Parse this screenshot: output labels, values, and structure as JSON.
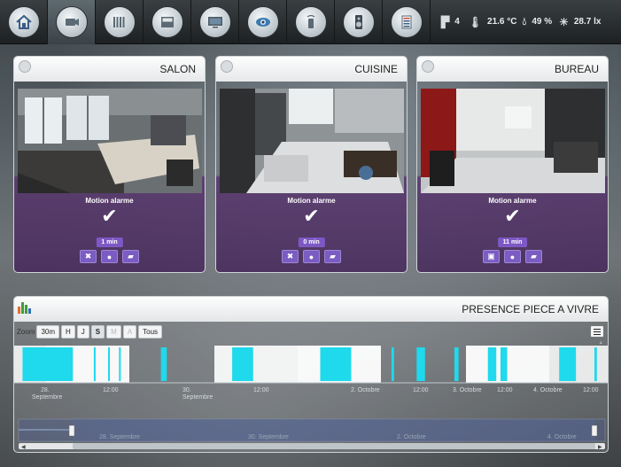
{
  "nav": {
    "items": [
      {
        "name": "home",
        "icon": "home-icon",
        "active": false
      },
      {
        "name": "camera",
        "icon": "camera-icon",
        "active": true
      },
      {
        "name": "heating",
        "icon": "radiator-icon",
        "active": false
      },
      {
        "name": "shutters",
        "icon": "shutter-icon",
        "active": false
      },
      {
        "name": "tv",
        "icon": "tv-icon",
        "active": false
      },
      {
        "name": "security",
        "icon": "eye-icon",
        "active": false
      },
      {
        "name": "remote",
        "icon": "remote-icon",
        "active": false
      },
      {
        "name": "audio",
        "icon": "speaker-icon",
        "active": false
      },
      {
        "name": "dashboard",
        "icon": "list-icon",
        "active": false
      }
    ]
  },
  "status": {
    "doors_open": "4",
    "temperature": "21.6 °C",
    "humidity": "49 %",
    "luminosity": "28.7 lx"
  },
  "cameras": [
    {
      "title": "SALON",
      "caption": "Motion alarme",
      "time": "1 min",
      "buttons": [
        "close-icon",
        "record-icon",
        "folder-icon"
      ]
    },
    {
      "title": "CUISINE",
      "caption": "Motion alarme",
      "time": "0 min",
      "buttons": [
        "close-icon",
        "record-icon",
        "folder-icon"
      ]
    },
    {
      "title": "BUREAU",
      "caption": "Motion alarme",
      "time": "11 min",
      "buttons": [
        "image-icon",
        "record-icon",
        "folder-icon"
      ]
    }
  ],
  "presence": {
    "title": "PRESENCE PIECE A VIVRE",
    "zoom_label": "Zoom",
    "zoom_buttons": [
      {
        "label": "30m",
        "state": "normal"
      },
      {
        "label": "H",
        "state": "normal"
      },
      {
        "label": "J",
        "state": "normal"
      },
      {
        "label": "S",
        "state": "selected"
      },
      {
        "label": "M",
        "state": "disabled"
      },
      {
        "label": "A",
        "state": "disabled"
      },
      {
        "label": "Tous",
        "state": "normal"
      }
    ],
    "axis_labels": [
      "28.",
      "Septembre",
      "12:00",
      "30.",
      "Septembre",
      "12:00",
      "2. Octobre",
      "12:00",
      "3. Octobre",
      "12:00",
      "4. Octobre",
      "12:00"
    ],
    "navigator_labels": [
      "28. Septembre",
      "30. Septembre",
      "2. Octobre",
      "4. Octobre"
    ],
    "chart_y_label": "1"
  },
  "chart_data": {
    "type": "bar",
    "title": "PRESENCE PIECE A VIVRE",
    "xlabel": "",
    "ylabel": "",
    "ylim": [
      0,
      1
    ],
    "x_range": [
      "2014-09-27 20:00",
      "2014-10-04 22:00"
    ],
    "series": [
      {
        "values_description": "binary presence 0/1",
        "events": [
          {
            "start": "27.9",
            "end": "28.5"
          },
          {
            "start": "28.75",
            "end": "28.76"
          },
          {
            "start": "28.92",
            "end": "28.93"
          },
          {
            "start": "29.05",
            "end": "29.06"
          },
          {
            "start": "29.55",
            "end": "29.62"
          },
          {
            "start": "30.4",
            "end": "30.65"
          },
          {
            "start": "31.45",
            "end": "31.82"
          },
          {
            "start": "32.3",
            "end": "32.33"
          },
          {
            "start": "32.6",
            "end": "32.7"
          },
          {
            "start": "33.05",
            "end": "33.1"
          },
          {
            "start": "33.45",
            "end": "33.55"
          },
          {
            "start": "33.6",
            "end": "33.68"
          },
          {
            "start": "34.3",
            "end": "34.5"
          },
          {
            "start": "34.72",
            "end": "34.75"
          }
        ]
      }
    ]
  }
}
